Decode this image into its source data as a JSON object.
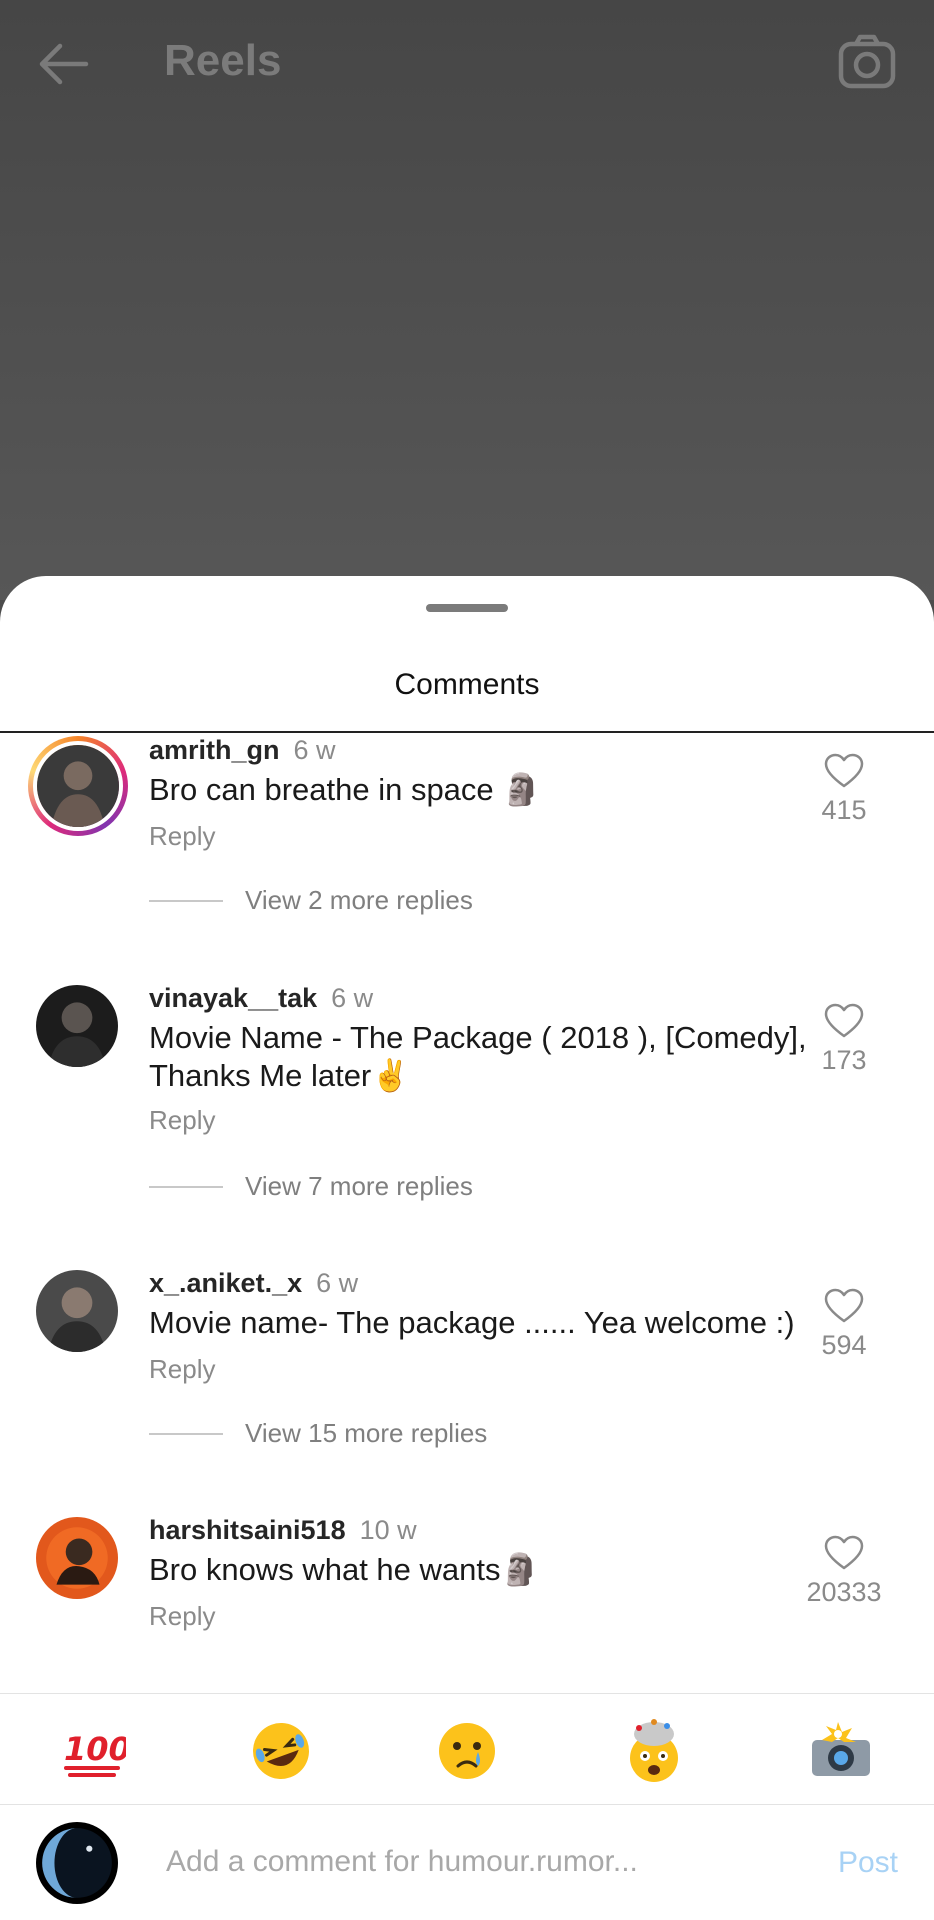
{
  "header": {
    "title": "Reels"
  },
  "sheet": {
    "title": "Comments"
  },
  "comments": [
    {
      "user": "amrith_gn",
      "time": "6 w",
      "text": "Bro can breathe in space 🗿",
      "reply_label": "Reply",
      "likes": "415",
      "view_replies": "View 2 more replies"
    },
    {
      "user": "vinayak__tak",
      "time": "6 w",
      "text": "Movie Name - The Package ( 2018 ), [Comedy], Thanks Me later✌️",
      "reply_label": "Reply",
      "likes": "173",
      "view_replies": "View 7 more replies"
    },
    {
      "user": "x_.aniket._x",
      "time": "6 w",
      "text": "Movie name- The package ...... Yea welcome :)",
      "reply_label": "Reply",
      "likes": "594",
      "view_replies": "View 15 more replies"
    },
    {
      "user": "harshitsaini518",
      "time": "10 w",
      "text": "Bro knows what he wants🗿",
      "reply_label": "Reply",
      "likes": "20333"
    }
  ],
  "emoji_bar": [
    "hundred-points",
    "rolling-laughing",
    "crying-face",
    "exploding-head",
    "camera-flash"
  ],
  "input": {
    "placeholder": "Add a comment for humour.rumor...",
    "value": "",
    "post_label": "Post"
  },
  "colors": {
    "accent_post": "#a8d2f5",
    "meta_gray": "#8a8a8a"
  }
}
